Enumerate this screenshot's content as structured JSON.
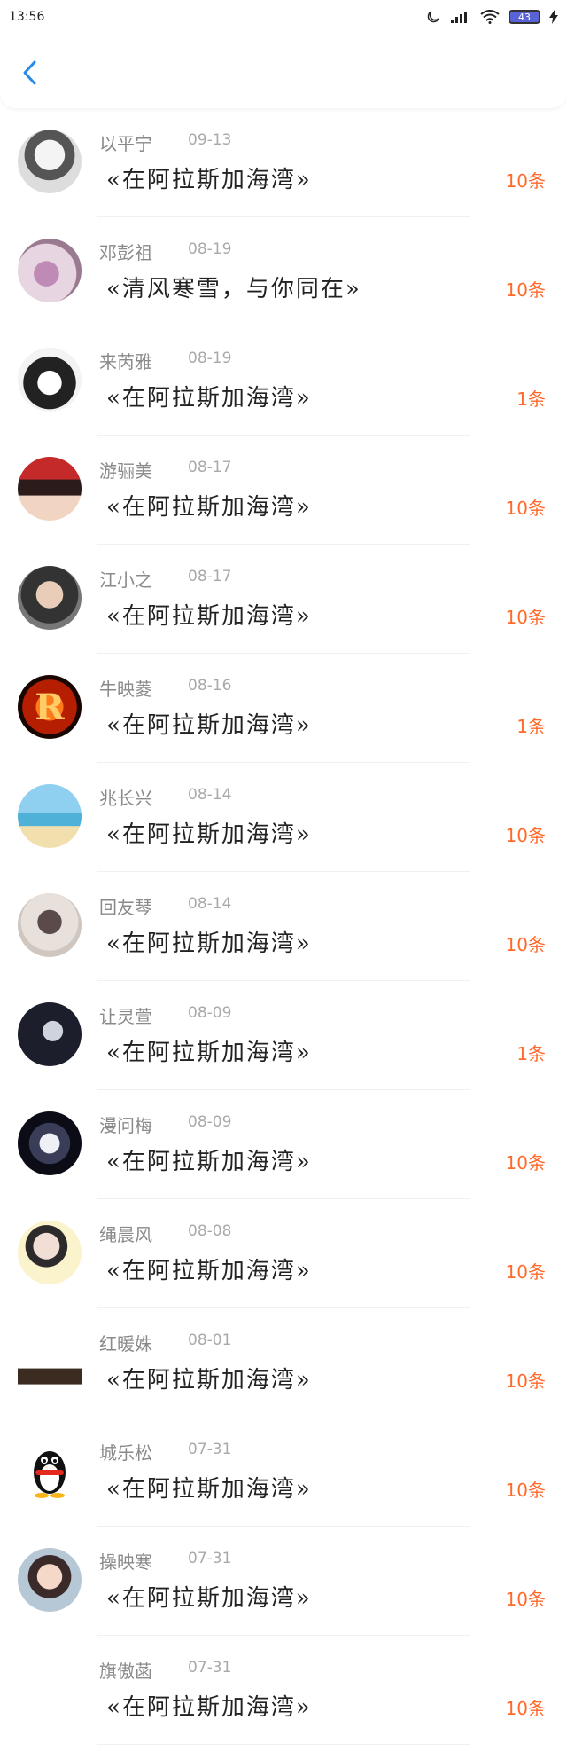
{
  "status_bar": {
    "time": "13:56",
    "battery": "43"
  },
  "header": {
    "back_icon": "chevron-left-icon"
  },
  "items": [
    {
      "name": "以平宁",
      "date": "09-13",
      "title": "«在阿拉斯加海湾»",
      "count": "10条",
      "avatar": "anime-girl"
    },
    {
      "name": "邓彭祖",
      "date": "08-19",
      "title": "«清风寒雪，与你同在»",
      "count": "10条",
      "avatar": "purple-flower"
    },
    {
      "name": "来芮雅",
      "date": "08-19",
      "title": "«在阿拉斯加海湾»",
      "count": "1条",
      "avatar": "anime-boy"
    },
    {
      "name": "游骊美",
      "date": "08-17",
      "title": "«在阿拉斯加海湾»",
      "count": "10条",
      "avatar": "woman-red"
    },
    {
      "name": "江小之",
      "date": "08-17",
      "title": "«在阿拉斯加海湾»",
      "count": "10条",
      "avatar": "child"
    },
    {
      "name": "牛映菱",
      "date": "08-16",
      "title": "«在阿拉斯加海湾»",
      "count": "1条",
      "avatar": "fire-r"
    },
    {
      "name": "兆长兴",
      "date": "08-14",
      "title": "«在阿拉斯加海湾»",
      "count": "10条",
      "avatar": "beach"
    },
    {
      "name": "回友琴",
      "date": "08-14",
      "title": "«在阿拉斯加海湾»",
      "count": "10条",
      "avatar": "woman-scarf"
    },
    {
      "name": "让灵萱",
      "date": "08-09",
      "title": "«在阿拉斯加海湾»",
      "count": "1条",
      "avatar": "couple-dark"
    },
    {
      "name": "漫问梅",
      "date": "08-09",
      "title": "«在阿拉斯加海湾»",
      "count": "10条",
      "avatar": "dark-girl"
    },
    {
      "name": "绳晨风",
      "date": "08-08",
      "title": "«在阿拉斯加海湾»",
      "count": "10条",
      "avatar": "girl-flowers"
    },
    {
      "name": "红暖姝",
      "date": "08-01",
      "title": "«在阿拉斯加海湾»",
      "count": "10条",
      "avatar": "sliver"
    },
    {
      "name": "城乐松",
      "date": "07-31",
      "title": "«在阿拉斯加海湾»",
      "count": "10条",
      "avatar": "qq-penguin"
    },
    {
      "name": "操映寒",
      "date": "07-31",
      "title": "«在阿拉斯加海湾»",
      "count": "10条",
      "avatar": "child-hat"
    },
    {
      "name": "旗傲菡",
      "date": "07-31",
      "title": "«在阿拉斯加海湾»",
      "count": "10条",
      "avatar": "none"
    }
  ]
}
